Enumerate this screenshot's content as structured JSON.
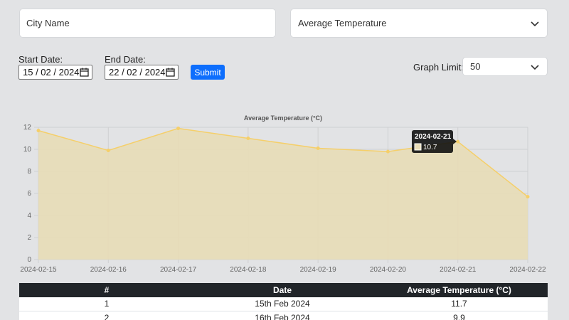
{
  "filters": {
    "city_placeholder": "City Name",
    "metric_selected": "Average Temperature",
    "start_label": "Start Date:",
    "start_value": "15 / 02 / 2024",
    "end_label": "End Date:",
    "end_value": "22 / 02 / 2024",
    "submit_label": "Submit",
    "limit_label": "Graph Limit:",
    "limit_value": "50"
  },
  "colors": {
    "fill": "#e8dcb6",
    "line": "#f5cf6a",
    "accent": "#0d6efd"
  },
  "chart_data": {
    "type": "area",
    "title": "Average Temperature (°C)",
    "categories": [
      "2024-02-15",
      "2024-02-16",
      "2024-02-17",
      "2024-02-18",
      "2024-02-19",
      "2024-02-20",
      "2024-02-21",
      "2024-02-22"
    ],
    "values": [
      11.7,
      9.9,
      11.9,
      11.0,
      10.1,
      9.8,
      10.7,
      5.7
    ],
    "ylim": [
      0,
      12
    ],
    "yticks": [
      "0",
      "2",
      "4",
      "6",
      "8",
      "10",
      "12"
    ],
    "grid": true,
    "tooltip": {
      "title": "2024-02-21",
      "value": "10.7"
    }
  },
  "table": {
    "headers": [
      "#",
      "Date",
      "Average Temperature (°C)"
    ],
    "rows": [
      [
        "1",
        "15th Feb 2024",
        "11.7"
      ],
      [
        "2",
        "16th Feb 2024",
        "9.9"
      ]
    ]
  }
}
